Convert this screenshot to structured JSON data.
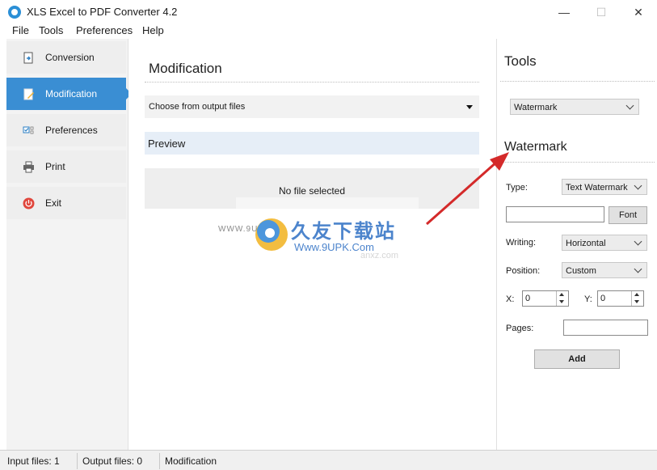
{
  "window": {
    "title": "XLS Excel to PDF Converter 4.2",
    "minimize_glyph": "—",
    "maximize_glyph": "☐",
    "close_glyph": "✕"
  },
  "menu": [
    "File",
    "Tools",
    "Preferences",
    "Help"
  ],
  "sidebar": {
    "items": [
      {
        "label": "Conversion",
        "icon": "conversion-icon",
        "active": false
      },
      {
        "label": "Modification",
        "icon": "modification-icon",
        "active": true
      },
      {
        "label": "Preferences",
        "icon": "preferences-icon",
        "active": false
      },
      {
        "label": "Print",
        "icon": "printer-icon",
        "active": false
      },
      {
        "label": "Exit",
        "icon": "power-icon",
        "active": false
      }
    ]
  },
  "main": {
    "title": "Modification",
    "file_select": "Choose from output files",
    "preview_label": "Preview",
    "empty_message": "No file selected"
  },
  "tools": {
    "title": "Tools",
    "tool_select": "Watermark",
    "watermark": {
      "title": "Watermark",
      "type_label": "Type:",
      "type_value": "Text Watermark",
      "text_value": "",
      "font_button": "Font",
      "writing_label": "Writing:",
      "writing_value": "Horizontal",
      "position_label": "Position:",
      "position_value": "Custom",
      "x_label": "X:",
      "x_value": "0",
      "y_label": "Y:",
      "y_value": "0",
      "pages_label": "Pages:",
      "pages_value": "",
      "add_button": "Add"
    }
  },
  "status": {
    "input_files": "Input files: 1",
    "output_files": "Output files: 0",
    "mode": "Modification"
  },
  "overlay": {
    "logo_text": "久友下载站",
    "logo_url": "Www.9UPK.Com",
    "logo_prefix": "WWW.9U",
    "logo_faint": "anxz.com"
  },
  "colors": {
    "accent": "#3a8ed3",
    "annotation_arrow": "#d42a2a"
  }
}
